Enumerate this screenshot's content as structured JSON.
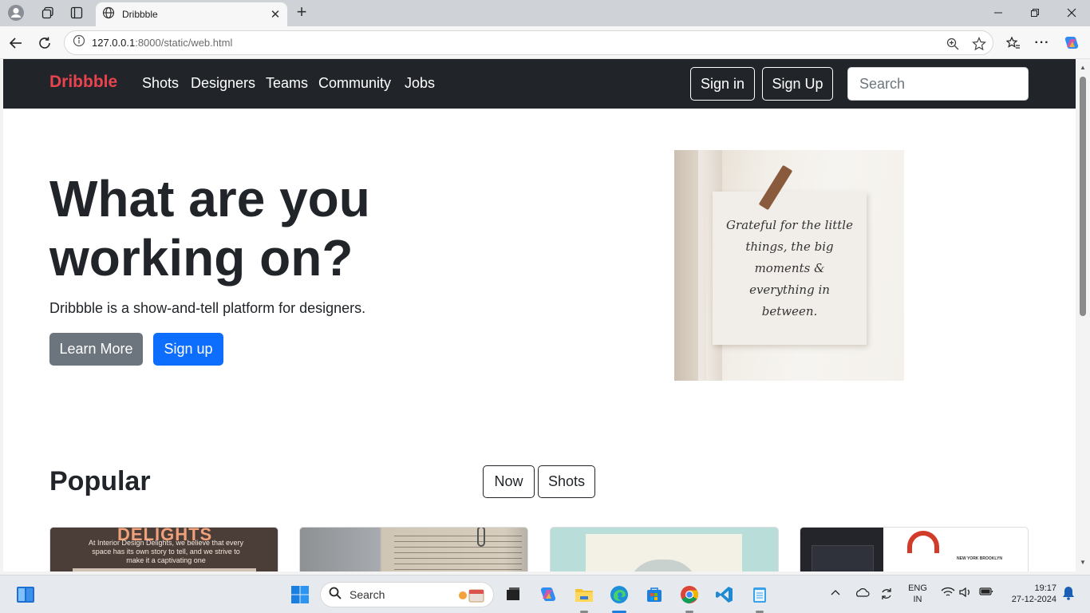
{
  "browser": {
    "tab_title": "Dribbble",
    "url_host": "127.0.0.1",
    "url_rest": ":8000/static/web.html"
  },
  "site": {
    "brand": "Dribbble",
    "nav": [
      "Shots",
      "Designers",
      "Teams",
      "Community",
      "Jobs"
    ],
    "sign_in": "Sign in",
    "sign_up_nav": "Sign Up",
    "search_placeholder": "Search",
    "hero_title": "What are you working on?",
    "hero_subtitle": "Dribbble is a show-and-tell platform for designers.",
    "learn_more": "Learn More",
    "sign_up_hero": "Sign up",
    "hero_note": "Grateful for the little things, the big moments & everything in between.",
    "popular_title": "Popular",
    "filter_now": "Now",
    "filter_shots": "Shots",
    "card1_title": "DELIGHTS",
    "card1_text": "At Interior Design Delights, we believe that every space has its own story to tell, and we strive to make it a captivating one",
    "card4_text": "NEW YORK BROOKLYN"
  },
  "taskbar": {
    "search_label": "Search",
    "lang_top": "ENG",
    "lang_bottom": "IN",
    "time": "19:17",
    "date": "27-12-2024"
  },
  "colors": {
    "brand": "#e8434f",
    "navbar": "#212529",
    "primary": "#0d6efd",
    "secondary": "#6c757d"
  }
}
